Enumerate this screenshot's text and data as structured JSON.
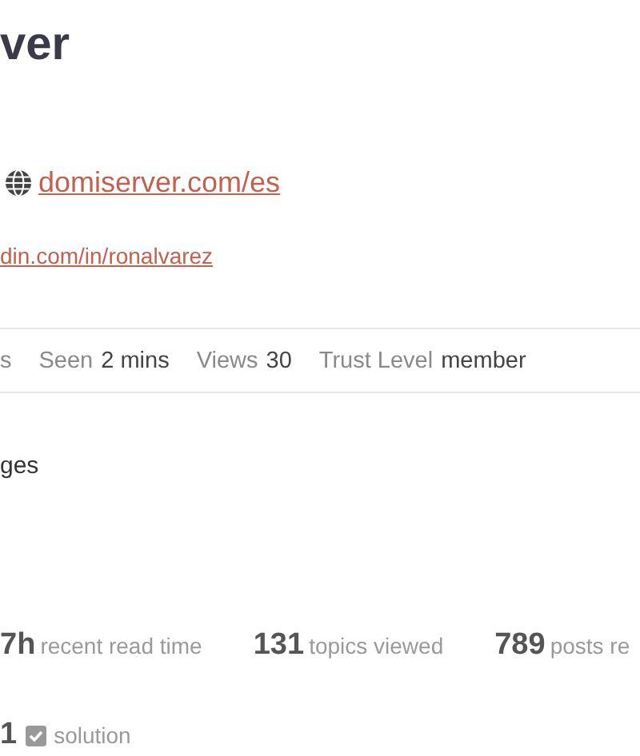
{
  "profile": {
    "name": "ver",
    "website": "domiserver.com/es",
    "bio_link": "din.com/in/ronalvarez"
  },
  "meta": [
    {
      "label": "s"
    },
    {
      "label": "Seen",
      "value": "2 mins"
    },
    {
      "label": "Views",
      "value": "30"
    },
    {
      "label": "Trust Level",
      "value": "member"
    }
  ],
  "section_text": "ges",
  "stats": [
    {
      "value": "7h",
      "label": "recent read time"
    },
    {
      "value": "131",
      "label": "topics viewed"
    },
    {
      "value": "789",
      "label": "posts re"
    }
  ],
  "solutions": {
    "value": "1",
    "label": "solution"
  }
}
